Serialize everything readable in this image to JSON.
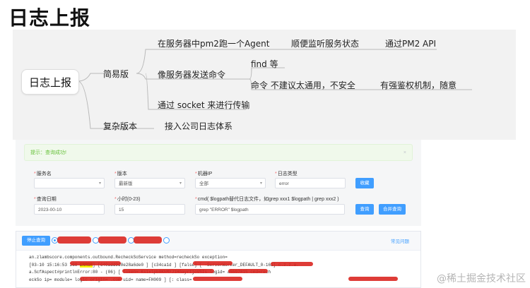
{
  "title": "日志上报",
  "mindmap": {
    "root": "日志上报",
    "simple": "简易版",
    "complex": "复杂版本",
    "n_pm2_agent": "在服务器中pm2跑一个Agent",
    "n_monitor": "顺便监听服务状态",
    "n_pm2_api": "通过PM2 API",
    "n_send_cmd": "像服务器发送命令",
    "n_find": "find 等",
    "n_cmd_warn": "命令 不建议太通用，不安全",
    "n_auth": "有强鉴权机制，随意",
    "n_socket": "通过 socket 来进行传输",
    "n_company": "接入公司日志体系"
  },
  "form": {
    "alert": "提示：查询成功!",
    "service_label": "服务名",
    "service_value": "",
    "version_label": "版本",
    "version_value": "最新版",
    "ip_label": "机器IP",
    "ip_value": "全部",
    "logtype_label": "日志类型",
    "logtype_value": "error",
    "collect_btn": "收藏",
    "date_label": "查询日期",
    "date_value": "2023-00-10",
    "hour_label": "小时(0-23)",
    "hour_value": "15",
    "cmd_label": "cmd( $logpath替代日志文件，如grep xxx1 $logpath | grep xxx2 )",
    "cmd_value": "grep \"ERROR\" $logpath",
    "query_btn": "查询",
    "merge_btn": "合并查询"
  },
  "log": {
    "stop_btn": "停止查询",
    "faq": "常见问题",
    "line1": "an.zlambscore.components.outbound.RecheckSoService  method=recheckSo  exception=",
    "line2a": "[03-10 15:16:53 268 ",
    "line2_level": "ERROR",
    "line2b": "] [640add9d0e28a6de0                    ] [c34ca1d      ] [false] [             -ServerWorker_DEFAULT_0-162] c.z.z.a.",
    "line3": "a.ScfAspect#printlnError:80 - (06) [ token=                    Ksixlpb0KhMYJ1HGayrtjoVSIs logid=        a5597815 cmd=rech",
    "line4": "eckSo ip=           module=           logic  origin=           .com uid=          name=FH009  ] [:  class=         "
  },
  "watermark": "@稀土掘金技术社区",
  "colors": {
    "accent": "#409eff",
    "success": "#67c23a",
    "redaction": "#d9211b"
  }
}
